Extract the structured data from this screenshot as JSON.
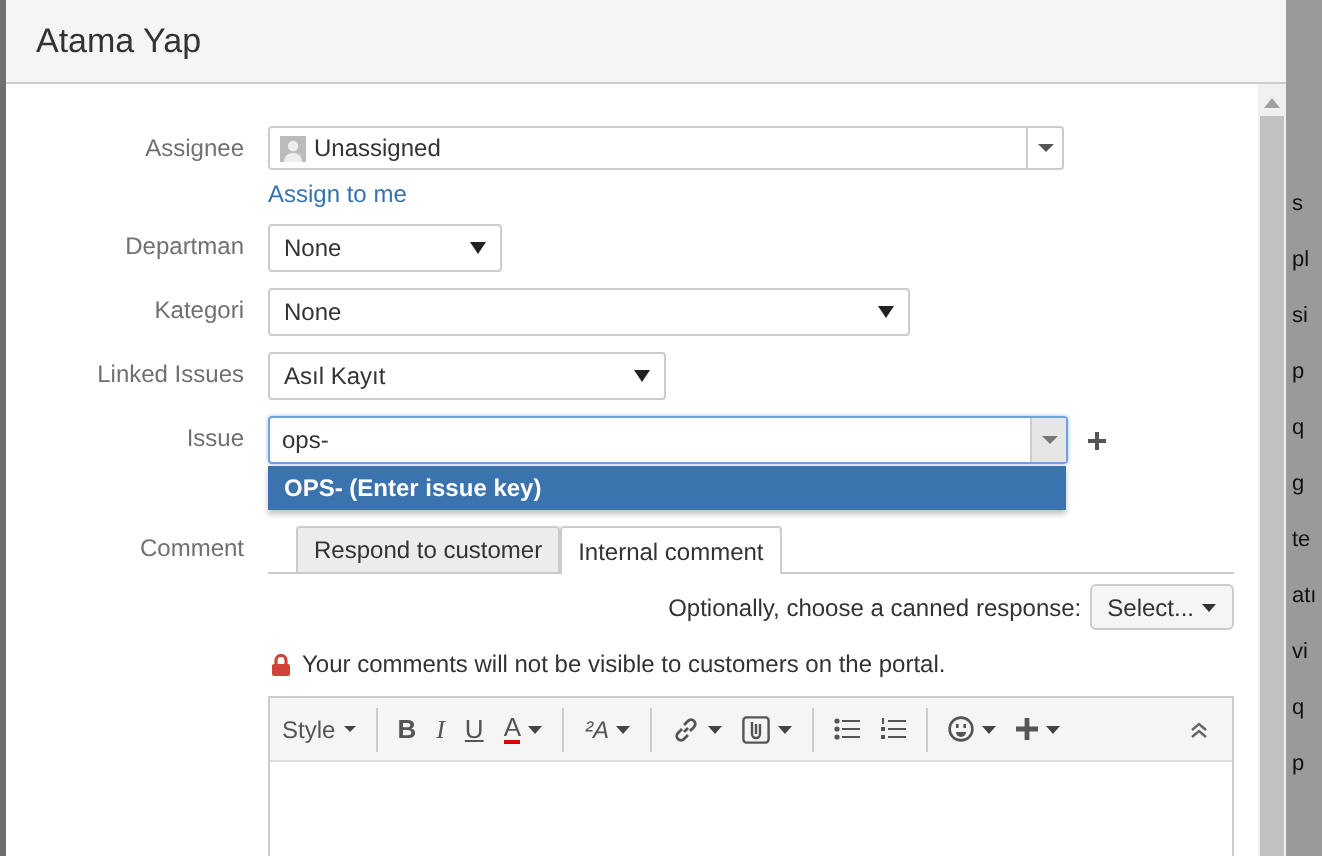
{
  "dialog": {
    "title": "Atama Yap"
  },
  "fields": [
    {
      "kind": "user-select",
      "label": "Assignee",
      "value": "Unassigned",
      "link": "Assign to me"
    },
    {
      "kind": "select",
      "label": "Departman",
      "value": "None"
    },
    {
      "kind": "select",
      "label": "Kategori",
      "value": "None"
    },
    {
      "kind": "select",
      "label": "Linked Issues",
      "value": "Asıl Kayıt"
    },
    {
      "kind": "combo",
      "label": "Issue",
      "value": "ops-",
      "focused": true,
      "suggestions": [
        {
          "text": "OPS- (Enter issue key)",
          "selected": true
        }
      ]
    }
  ],
  "comment": {
    "label": "Comment",
    "tabs": [
      {
        "label": "Respond to customer",
        "selected": false
      },
      {
        "label": "Internal comment",
        "selected": true
      }
    ],
    "canned_label": "Optionally, choose a canned response:",
    "canned_button": "Select...",
    "notice": "Your comments will not be visible to customers on the portal.",
    "toolbar": [
      {
        "kind": "style",
        "label": "Style",
        "dropdown": true
      },
      {
        "kind": "separator"
      },
      {
        "kind": "bold",
        "label": "B",
        "dropdown": false
      },
      {
        "kind": "italic",
        "label": "I",
        "dropdown": false
      },
      {
        "kind": "underline",
        "label": "U",
        "dropdown": false
      },
      {
        "kind": "color",
        "label": "A",
        "dropdown": true
      },
      {
        "kind": "separator"
      },
      {
        "kind": "effects",
        "label": "²A",
        "dropdown": true
      },
      {
        "kind": "separator"
      },
      {
        "kind": "link",
        "dropdown": true
      },
      {
        "kind": "attachment",
        "dropdown": true
      },
      {
        "kind": "separator"
      },
      {
        "kind": "bullets",
        "dropdown": false
      },
      {
        "kind": "numbers",
        "dropdown": false
      },
      {
        "kind": "separator"
      },
      {
        "kind": "emoji",
        "dropdown": true
      },
      {
        "kind": "insert",
        "dropdown": true
      },
      {
        "kind": "collapse",
        "dropdown": false
      }
    ]
  },
  "background_page": {
    "fragments": [
      "s",
      "pl",
      "si",
      "p",
      "q",
      "g",
      "te",
      "atı",
      "vi",
      "q",
      "p"
    ]
  }
}
